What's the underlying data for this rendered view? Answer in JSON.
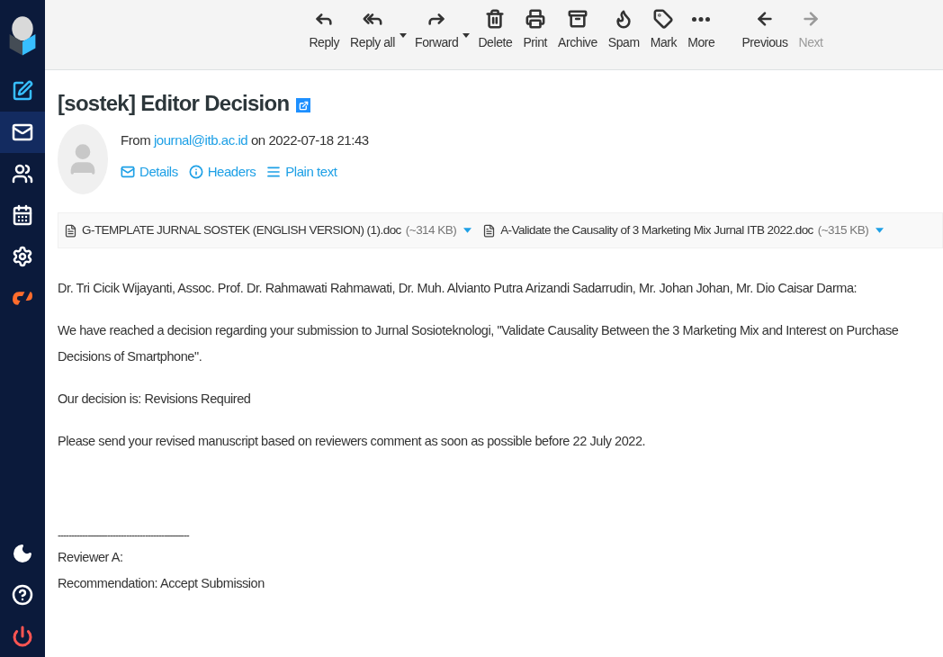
{
  "sidebar": {
    "items": [
      {
        "kind": "compose",
        "selected": false
      },
      {
        "kind": "mail",
        "selected": true
      },
      {
        "kind": "contacts",
        "selected": false
      },
      {
        "kind": "calendar",
        "selected": false
      },
      {
        "kind": "settings",
        "selected": false
      },
      {
        "kind": "cpanel",
        "selected": false
      }
    ],
    "bottom_items": [
      {
        "kind": "theme"
      },
      {
        "kind": "help"
      },
      {
        "kind": "logout"
      }
    ]
  },
  "toolbar": {
    "buttons": [
      {
        "kind": "reply",
        "label": "Reply",
        "dropdown": false,
        "disabled": false
      },
      {
        "kind": "reply-all",
        "label": "Reply all",
        "dropdown": true,
        "disabled": false
      },
      {
        "kind": "forward",
        "label": "Forward",
        "dropdown": true,
        "disabled": false
      },
      {
        "kind": "delete",
        "label": "Delete",
        "dropdown": false,
        "disabled": false
      },
      {
        "kind": "print",
        "label": "Print",
        "dropdown": false,
        "disabled": false
      },
      {
        "kind": "archive",
        "label": "Archive",
        "dropdown": false,
        "disabled": false
      },
      {
        "kind": "spam",
        "label": "Spam",
        "dropdown": false,
        "disabled": false
      },
      {
        "kind": "mark",
        "label": "Mark",
        "dropdown": false,
        "disabled": false
      },
      {
        "kind": "more",
        "label": "More",
        "dropdown": false,
        "disabled": false
      },
      {
        "kind": "previous",
        "label": "Previous",
        "dropdown": false,
        "disabled": false
      },
      {
        "kind": "next",
        "label": "Next",
        "dropdown": false,
        "disabled": true
      }
    ]
  },
  "message": {
    "subject": "[sostek] Editor Decision",
    "from": {
      "prefix": "From",
      "address": "journal@itb.ac.id",
      "suffix": "on 2022-07-18 21:43"
    },
    "header_links": [
      {
        "kind": "details",
        "label": "Details"
      },
      {
        "kind": "headers",
        "label": "Headers"
      },
      {
        "kind": "plain",
        "label": "Plain text"
      }
    ],
    "attachments": [
      {
        "name": "G-TEMPLATE JURNAL SOSTEK (ENGLISH VERSION) (1).doc",
        "size": "(~314 KB)"
      },
      {
        "name": "A-Validate the Causality of 3 Marketing Mix Jurnal ITB 2022.doc",
        "size": "(~315 KB)"
      }
    ],
    "body": [
      {
        "kind": "paragraph",
        "lines": [
          "Dr. Tri Cicik Wijayanti, Assoc. Prof. Dr. Rahmawati Rahmawati, Dr. Muh. Alvianto Putra Arizandi Sadarrudin, Mr. Johan Johan, Mr. Dio Caisar Darma:"
        ]
      },
      {
        "kind": "paragraph",
        "lines": [
          "We have reached a decision regarding your submission to Jurnal Sosioteknologi, \"Validate Causality Between the 3 Marketing Mix and Interest on Purchase Decisions of Smartphone\"."
        ]
      },
      {
        "kind": "paragraph",
        "lines": [
          "Our decision is: Revisions Required"
        ]
      },
      {
        "kind": "paragraph",
        "lines": [
          "Please send your revised manuscript based on reviewers comment as soon as possible before 22 July 2022."
        ]
      },
      {
        "kind": "signature",
        "lines": [
          "------------------------------------------------",
          "Reviewer A:",
          "Recommendation: Accept Submission"
        ]
      }
    ]
  }
}
